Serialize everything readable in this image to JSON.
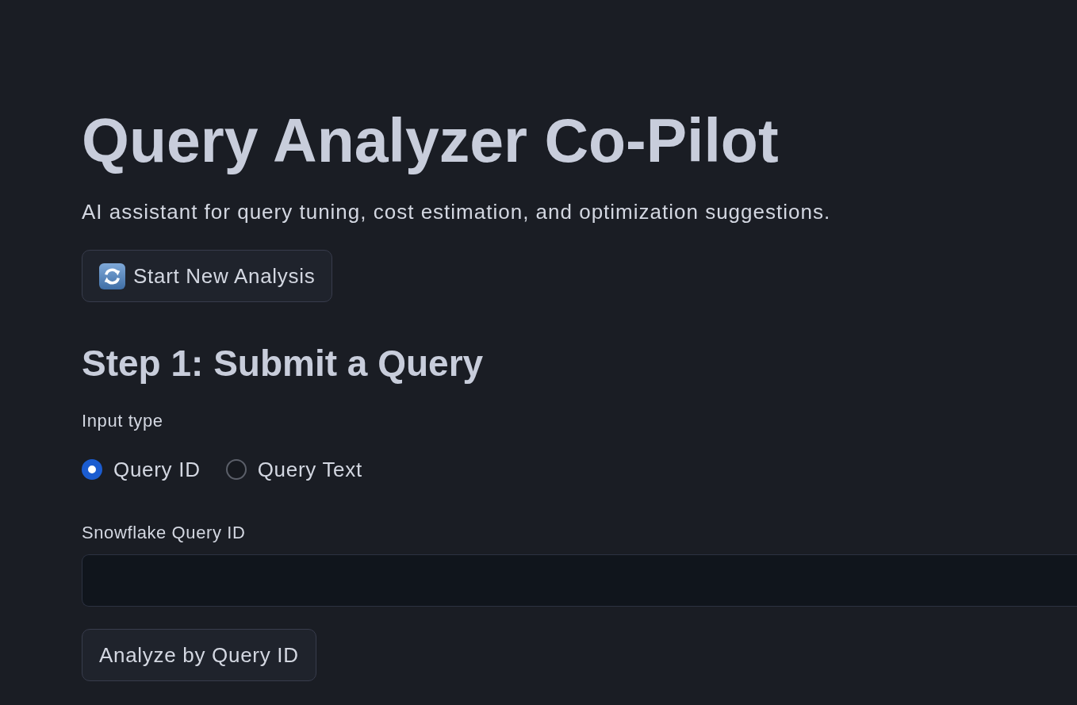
{
  "header": {
    "title": "Query Analyzer Co-Pilot",
    "subtitle": "AI assistant for query tuning, cost estimation, and optimization suggestions."
  },
  "new_analysis_button": {
    "label": "Start New Analysis"
  },
  "step": {
    "heading": "Step 1: Submit a Query",
    "input_type": {
      "label": "Input type",
      "options": [
        {
          "label": "Query ID",
          "selected": true
        },
        {
          "label": "Query Text",
          "selected": false
        }
      ]
    },
    "query_id_field": {
      "label": "Snowflake Query ID"
    },
    "analyze_button": {
      "label": "Analyze by Query ID"
    }
  }
}
